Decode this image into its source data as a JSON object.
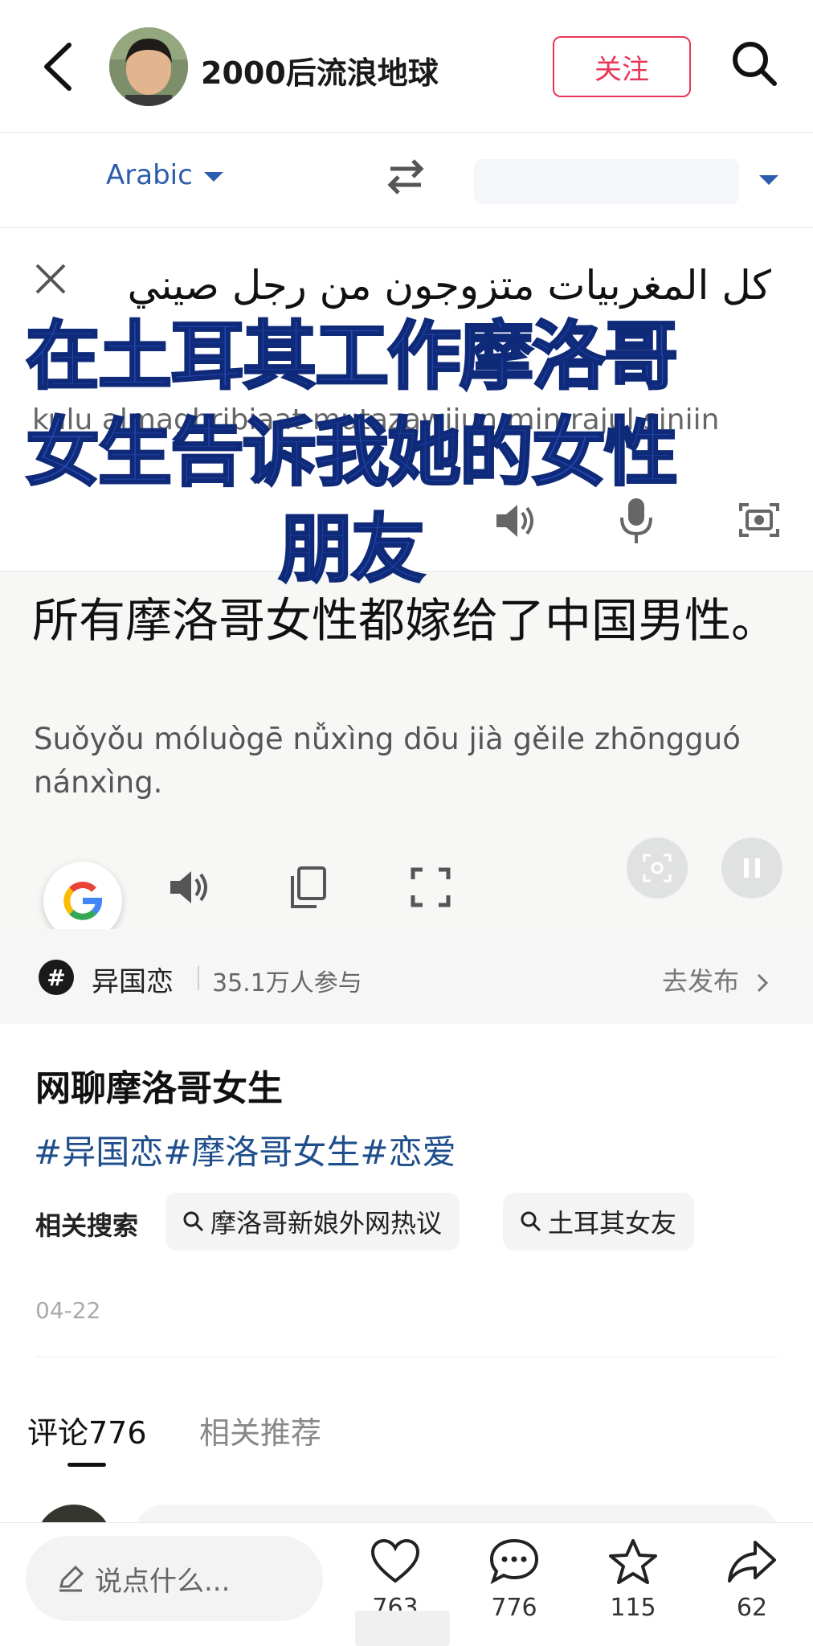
{
  "header": {
    "back_icon": "chevron-left-icon",
    "author": "2000后流浪地球",
    "follow_label": "关注",
    "search_icon": "search-icon"
  },
  "translate": {
    "source_lang": "Arabic",
    "source_text": "كل المغربيات متزوجون من رجل صيني",
    "transliteration": "kulu almaghribiaat mutazawijun min rajul siniin",
    "output_text": "所有摩洛哥女性都嫁给了中国男性。",
    "pinyin": "Suǒyǒu móluògē nǚxìng dōu jià gěile zhōngguó nánxìng.",
    "accent_color": "#2b5cad"
  },
  "overlay": {
    "lines": [
      "在土耳其工作摩洛哥",
      "女生告诉我她的女性",
      "朋友"
    ],
    "color": "#2349b4"
  },
  "topic": {
    "icon_label": "#",
    "name": "异国恋",
    "count": "35.1万人参与",
    "action": "去发布"
  },
  "post": {
    "title": "网聊摩洛哥女生",
    "tags": "#异国恋#摩洛哥女生#恋爱",
    "related_label": "相关搜索",
    "related": [
      "摩洛哥新娘外网热议",
      "土耳其女友"
    ],
    "date": "04-22"
  },
  "tabs": {
    "comments": "评论776",
    "recommend": "相关推荐"
  },
  "bottom": {
    "input_placeholder": "说点什么...",
    "likes": "763",
    "comments": "776",
    "favorites": "115",
    "shares": "62"
  }
}
